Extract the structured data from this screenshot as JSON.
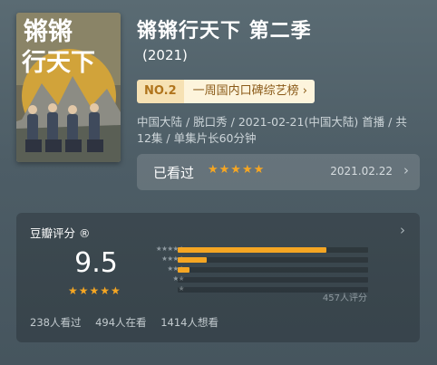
{
  "title": "锵锵行天下 第二季",
  "year": "(2021)",
  "poster": {
    "text_line1": "锵锵",
    "text_line2": "行天下"
  },
  "rank": {
    "number": "NO.2",
    "list_name": "一周国内口碑综艺榜"
  },
  "meta": "中国大陆 / 脱口秀 / 2021-02-21(中国大陆) 首播 / 共12集 / 单集片长60分钟",
  "watched": {
    "label": "已看过",
    "stars": "★★★★★",
    "date": "2021.02.22"
  },
  "rating": {
    "title": "豆瓣评分",
    "reg": "®",
    "score": "9.5",
    "stars": "★★★★★",
    "count_text": "457人评分",
    "distribution": [
      {
        "stars": "★★★★★",
        "percent": 0.78
      },
      {
        "stars": "★★★★",
        "percent": 0.15
      },
      {
        "stars": "★★★",
        "percent": 0.06
      },
      {
        "stars": "★★",
        "percent": 0.0
      },
      {
        "stars": "★",
        "percent": 0.0
      }
    ],
    "stats": [
      {
        "label": "238人看过"
      },
      {
        "label": "494人在看"
      },
      {
        "label": "1414人想看"
      }
    ]
  },
  "colors": {
    "accent": "#f5a623",
    "rank_bg": "#fdf4dc",
    "rank_no_bg": "#f6e1b3"
  }
}
